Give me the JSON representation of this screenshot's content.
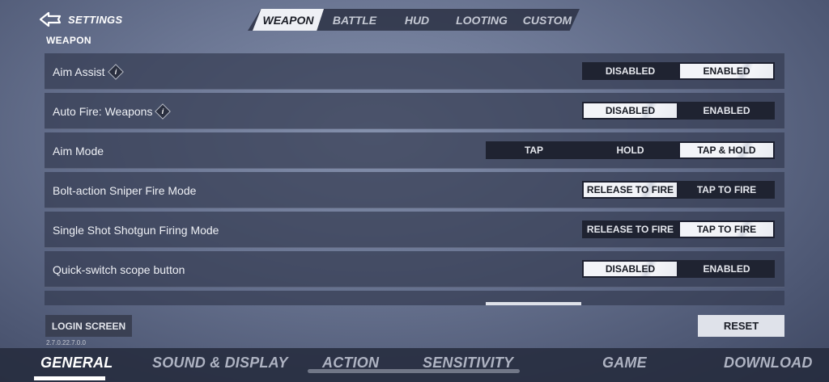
{
  "header": {
    "title": "SETTINGS",
    "tabs": [
      {
        "label": "WEAPON",
        "active": true
      },
      {
        "label": "BATTLE",
        "active": false
      },
      {
        "label": "HUD",
        "active": false
      },
      {
        "label": "LOOTING",
        "active": false
      },
      {
        "label": "CUSTOM",
        "active": false
      }
    ]
  },
  "section": {
    "title": "WEAPON"
  },
  "settings": [
    {
      "label": "Aim Assist",
      "info": true,
      "options": [
        "DISABLED",
        "ENABLED"
      ],
      "selected": "ENABLED"
    },
    {
      "label": "Auto Fire: Weapons",
      "info": true,
      "options": [
        "DISABLED",
        "ENABLED"
      ],
      "selected": "DISABLED"
    },
    {
      "label": "Aim Mode",
      "info": false,
      "options": [
        "TAP",
        "HOLD",
        "TAP & HOLD"
      ],
      "selected": "TAP & HOLD"
    },
    {
      "label": "Bolt-action Sniper Fire Mode",
      "info": false,
      "options": [
        "RELEASE TO FIRE",
        "TAP TO FIRE"
      ],
      "selected": "RELEASE TO FIRE"
    },
    {
      "label": "Single Shot Shotgun Firing Mode",
      "info": false,
      "options": [
        "RELEASE TO FIRE",
        "TAP TO FIRE"
      ],
      "selected": "TAP TO FIRE"
    },
    {
      "label": "Quick-switch scope button",
      "info": false,
      "options": [
        "DISABLED",
        "ENABLED"
      ],
      "selected": "DISABLED"
    }
  ],
  "footer": {
    "login_label": "LOGIN SCREEN",
    "version": "2.7.0.22.7.0.0",
    "reset_label": "RESET"
  },
  "bottom_nav": [
    {
      "label": "GENERAL",
      "active": true
    },
    {
      "label": "SOUND & DISPLAY",
      "active": false
    },
    {
      "label": "ACTION",
      "active": false
    },
    {
      "label": "SENSITIVITY",
      "active": false
    },
    {
      "label": "GAME",
      "active": false
    },
    {
      "label": "DOWNLOAD",
      "active": false
    }
  ],
  "icons": {
    "back": "back-arrow-icon",
    "info": "info-icon"
  },
  "colors": {
    "selected_bg": "#f3f4f8",
    "option_bg": "#1f2331",
    "row_bg": "#343b52"
  }
}
